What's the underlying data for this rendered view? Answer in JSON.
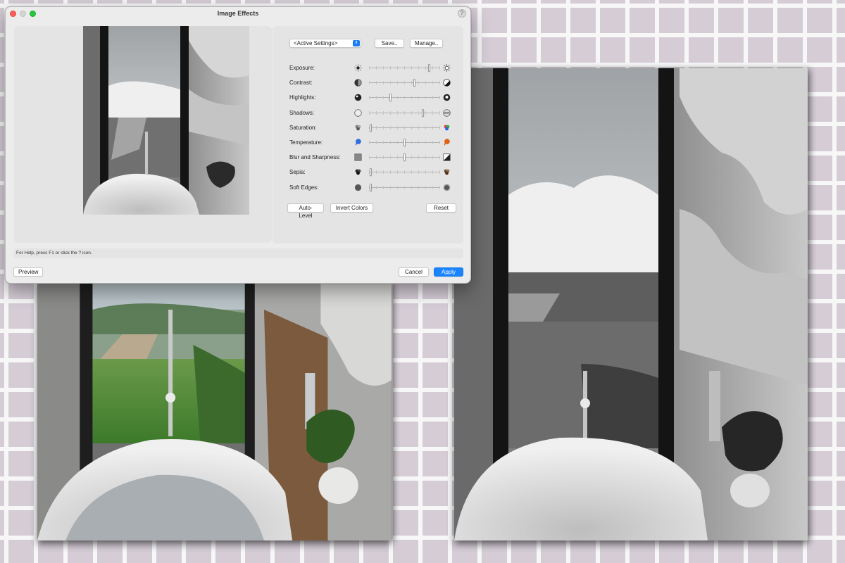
{
  "window": {
    "title": "Image Effects",
    "help_label": "?"
  },
  "preset": {
    "selected": "<Active Settings>",
    "save_label": "Save..",
    "manage_label": "Manage.."
  },
  "sliders": [
    {
      "key": "exposure",
      "label": "Exposure:",
      "value": 0.85,
      "icon_left": "sun-small-icon",
      "icon_right": "sun-large-icon"
    },
    {
      "key": "contrast",
      "label": "Contrast:",
      "value": 0.64,
      "icon_left": "contrast-low-icon",
      "icon_right": "contrast-high-icon"
    },
    {
      "key": "highlights",
      "label": "Highlights:",
      "value": 0.3,
      "icon_left": "highlights-low-icon",
      "icon_right": "highlights-high-icon"
    },
    {
      "key": "shadows",
      "label": "Shadows:",
      "value": 0.76,
      "icon_left": "shadows-low-icon",
      "icon_right": "shadows-high-icon"
    },
    {
      "key": "saturation",
      "label": "Saturation:",
      "value": 0.02,
      "icon_left": "saturation-low-icon",
      "icon_right": "saturation-high-icon"
    },
    {
      "key": "temperature",
      "label": "Temperature:",
      "value": 0.5,
      "icon_left": "temperature-cool-icon",
      "icon_right": "temperature-warm-icon"
    },
    {
      "key": "blur_sharpness",
      "label": "Blur and Sharpness:",
      "value": 0.5,
      "icon_left": "blur-icon",
      "icon_right": "sharpness-icon"
    },
    {
      "key": "sepia",
      "label": "Sepia:",
      "value": 0.02,
      "icon_left": "sepia-low-icon",
      "icon_right": "sepia-high-icon"
    },
    {
      "key": "soft_edges",
      "label": "Soft Edges:",
      "value": 0.02,
      "icon_left": "soft-edges-low-icon",
      "icon_right": "soft-edges-high-icon"
    }
  ],
  "actions": {
    "auto_level": "Auto-Level",
    "invert_colors": "Invert Colors",
    "reset": "Reset"
  },
  "status_text": "For Help, press F1 or click the ? icon.",
  "footer": {
    "preview": "Preview",
    "cancel": "Cancel",
    "apply": "Apply"
  },
  "colors": {
    "accent": "#1a84ff",
    "close": "#fe5f57",
    "maximize": "#28c840"
  }
}
